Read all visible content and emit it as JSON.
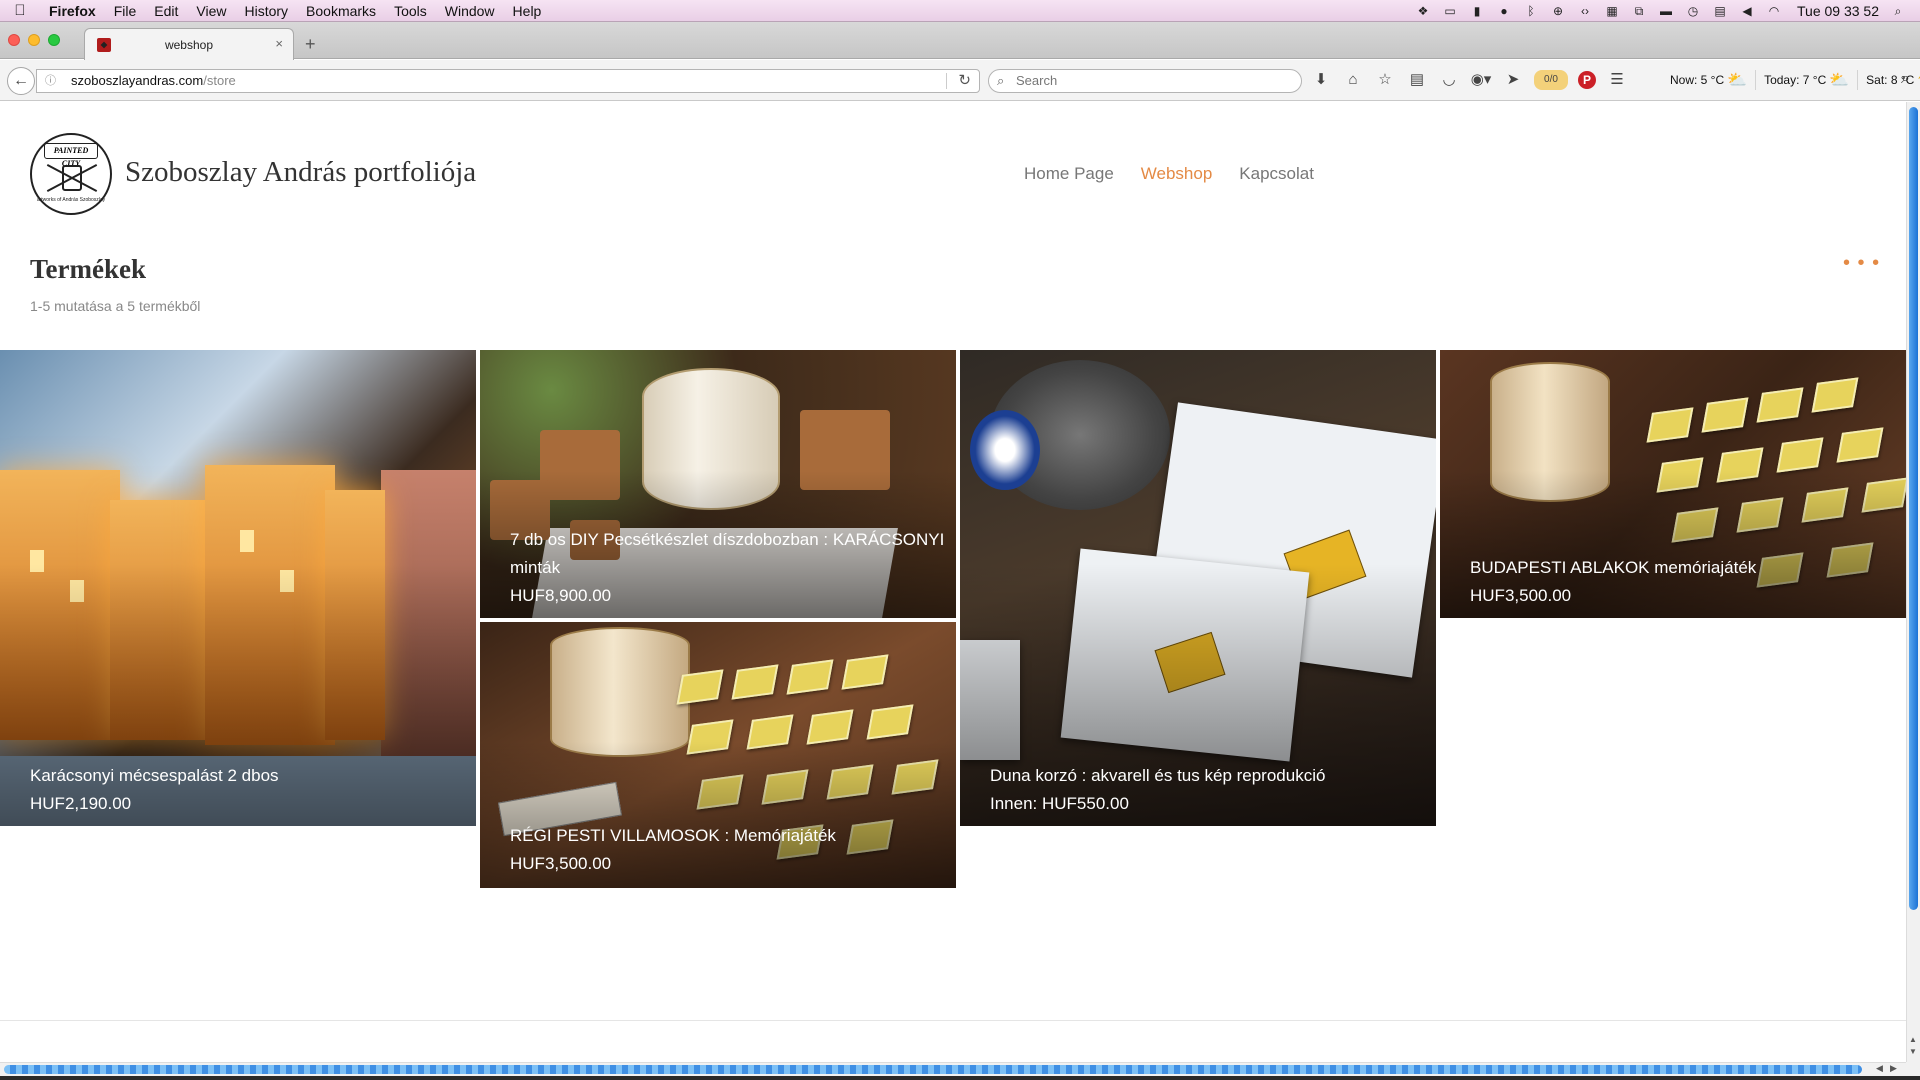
{
  "menubar": {
    "app": "Firefox",
    "items": [
      "File",
      "Edit",
      "View",
      "History",
      "Bookmarks",
      "Tools",
      "Window",
      "Help"
    ],
    "clock": "Tue 09 33 52",
    "tray_icons": [
      "dropbox-icon",
      "display-icon",
      "battery-monitor-icon",
      "antivirus-icon",
      "bluetooth-icon",
      "accessibility-icon",
      "code-icon",
      "grid-icon",
      "screenshot-icon",
      "monitor-icon",
      "time-machine-icon",
      "calendar-icon",
      "volume-icon",
      "wifi-icon"
    ]
  },
  "tab": {
    "title": "webshop",
    "close": "×",
    "new_tab": "+"
  },
  "navbar": {
    "url_host": "szoboszlayandras.com",
    "url_path": "/store",
    "search_placeholder": "Search",
    "badge": "0/0",
    "weather": [
      {
        "label": "Now: 5 °C"
      },
      {
        "label": "Today: 7 °C"
      },
      {
        "label": "Sat: 8 °C"
      }
    ]
  },
  "site": {
    "logo_text": "PAINTED CITY",
    "logo_sub": "artworks of András Szoboszlay",
    "title": "Szoboszlay András portfoliója",
    "nav": [
      {
        "label": "Home Page",
        "active": false
      },
      {
        "label": "Webshop",
        "active": true
      },
      {
        "label": "Kapcsolat",
        "active": false
      }
    ],
    "accent_color": "#e48a45"
  },
  "store": {
    "heading": "Termékek",
    "result_count": "1-5 mutatása a 5 termékből",
    "more": "• • •",
    "products": [
      {
        "name": "Karácsonyi mécsespalást 2 dbos",
        "price": "HUF2,190.00"
      },
      {
        "name": "7 db os DIY Pecsétkészlet díszdobozban : KARÁCSONYI minták",
        "price": "HUF8,900.00"
      },
      {
        "name": "Duna korzó : akvarell és tus kép reprodukció",
        "price": "Innen: HUF550.00"
      },
      {
        "name": "BUDAPESTI ABLAKOK memóriajáték",
        "price": "HUF3,500.00"
      },
      {
        "name": "RÉGI PESTI VILLAMOSOK : Memóriajáték",
        "price": "HUF3,500.00"
      }
    ]
  }
}
